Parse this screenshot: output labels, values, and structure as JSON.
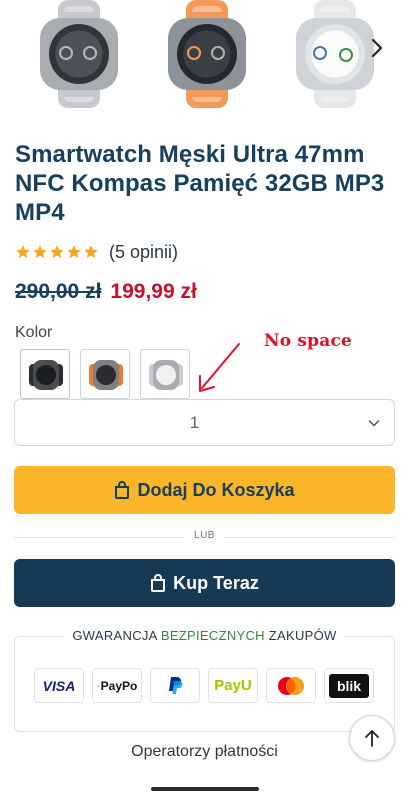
{
  "gallery": {
    "items": [
      {
        "name": "silver watch with grey band",
        "band_color": "#c7c9cc",
        "case_color": "#a9adb2",
        "dial_color": "#3c4147"
      },
      {
        "name": "orange watch",
        "band_color": "#f39a5a",
        "case_color": "#8e9399",
        "dial_color": "#2f3338"
      },
      {
        "name": "white watch",
        "band_color": "#e6e7e9",
        "case_color": "#cfd2d6",
        "dial_color": "#f4f5f6"
      }
    ],
    "next_icon": "chevron-right-icon"
  },
  "product": {
    "title": "Smartwatch Męski Ultra 47mm NFC Kompas Pamięć 32GB MP3 MP4",
    "rating": 5,
    "reviews": "(5 opinii)",
    "old_price": "290,00 zł",
    "price": "199,99 zł"
  },
  "variant": {
    "label": "Kolor",
    "options": [
      {
        "name": "black",
        "band": "#2b2d30",
        "dial": "#1b1d20"
      },
      {
        "name": "orange",
        "band": "#ef7a2c",
        "dial": "#2a2c2f"
      },
      {
        "name": "silver",
        "band": "#c9cbce",
        "dial": "#f0f1f2"
      }
    ]
  },
  "annotation": {
    "text": "No space"
  },
  "quantity": {
    "value": "1"
  },
  "actions": {
    "add_to_cart": "Dodaj Do Koszyka",
    "or": "LUB",
    "buy_now": "Kup Teraz"
  },
  "guarantee": {
    "prefix": "GWARANCJA ",
    "highlight": "BEZPIECZNYCH",
    "suffix": " ZAKUPÓW",
    "methods": [
      "VISA",
      "PayPo",
      "PayPal",
      "PayU",
      "Mastercard",
      "blik"
    ]
  },
  "footer": {
    "operators": "Operatorzy płatności"
  },
  "colors": {
    "title": "#17405e",
    "price": "#c8102e",
    "cart_button": "#fbb52a",
    "buy_button": "#163a55",
    "star": "#f5a623"
  }
}
